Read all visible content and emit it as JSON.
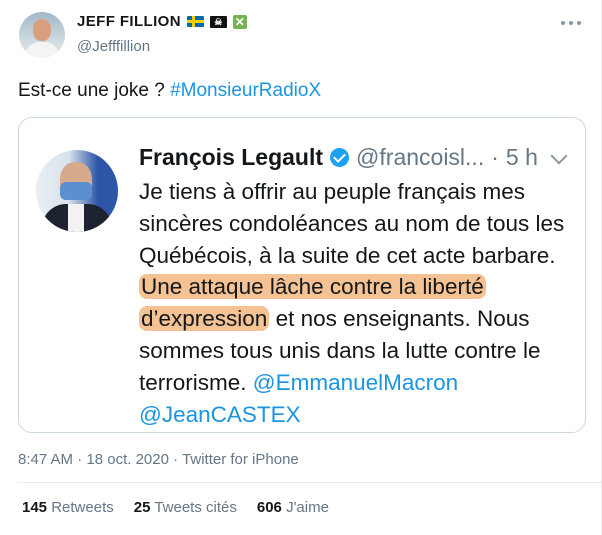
{
  "author": {
    "name": "JEFF FILLION",
    "handle": "@Jefffillion",
    "badges": [
      "flag-sweden",
      "pirate-flag",
      "cross-mark"
    ]
  },
  "tweet": {
    "text": "Est-ce une joke ? ",
    "hashtag": "#MonsieurRadioX"
  },
  "embedded_tweet": {
    "name": "François Legault",
    "handle": "@francoisl...",
    "separator": "·",
    "time": "5 h",
    "text_part1": "Je tiens à offrir au peuple français mes sincères condoléances au nom de tous les Québécois, à la suite de cet acte barbare. ",
    "highlight": "Une attaque lâche contre la liberté d’expression",
    "text_part2": " et nos enseignants. Nous sommes tous unis dans la lutte contre le terrorisme. ",
    "mention1": "@EmmanuelMacron",
    "mention2": "@JeanCASTEX"
  },
  "meta": {
    "time": "8:47 AM",
    "separator1": "·",
    "date": "18 oct. 2020",
    "separator2": "·",
    "source": "Twitter for iPhone"
  },
  "stats": {
    "retweets_count": "145",
    "retweets_label": "Retweets",
    "quotes_count": "25",
    "quotes_label": "Tweets cités",
    "likes_count": "606",
    "likes_label": "J'aime"
  },
  "colors": {
    "link": "#1b95e0",
    "highlight": "#f5c293",
    "muted": "#657786",
    "verified": "#1da1f2"
  }
}
